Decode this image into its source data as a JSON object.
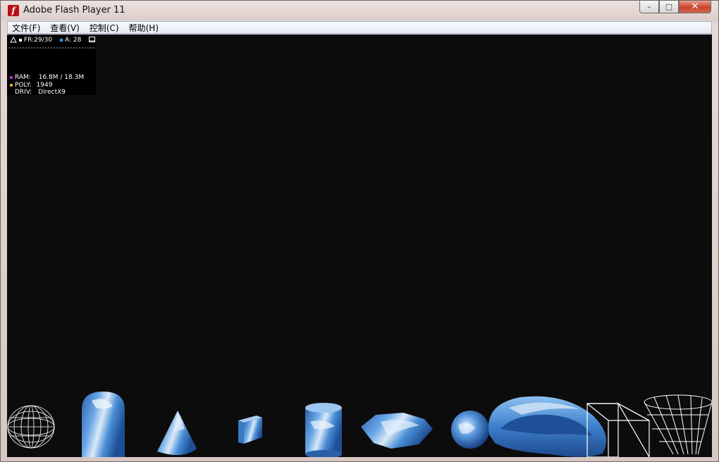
{
  "window": {
    "title": "Adobe Flash Player 11",
    "icon": "flash-player-icon",
    "controls": {
      "minimize": "–",
      "maximize": "□",
      "close": "✕"
    }
  },
  "menubar": {
    "items": [
      {
        "label": "文件(F)"
      },
      {
        "label": "查看(V)"
      },
      {
        "label": "控制(C)"
      },
      {
        "label": "帮助(H)"
      }
    ]
  },
  "stats": {
    "fr": "FR:29/30",
    "a": "A: 28",
    "ram_label": "RAM:",
    "ram_value": "16.8M / 18.3M",
    "poly_label": "POLY:",
    "poly_value": "1949",
    "driv_label": "DRIV:",
    "driv_value": "DirectX9"
  },
  "colors": {
    "stage_bg": "#0c0c0c",
    "ram_marker": "#c02cc0",
    "poly_marker": "#e0a030",
    "fr_marker": "#ffffff",
    "a_marker": "#3aa0ff",
    "shape_blue": "#4a8fd6"
  },
  "shapes": [
    "wireframe-sphere",
    "textured-capsule",
    "textured-cone",
    "textured-cube",
    "textured-cylinder",
    "textured-octagon-prism",
    "textured-sphere",
    "textured-torus",
    "wireframe-cube",
    "wireframe-cone"
  ]
}
